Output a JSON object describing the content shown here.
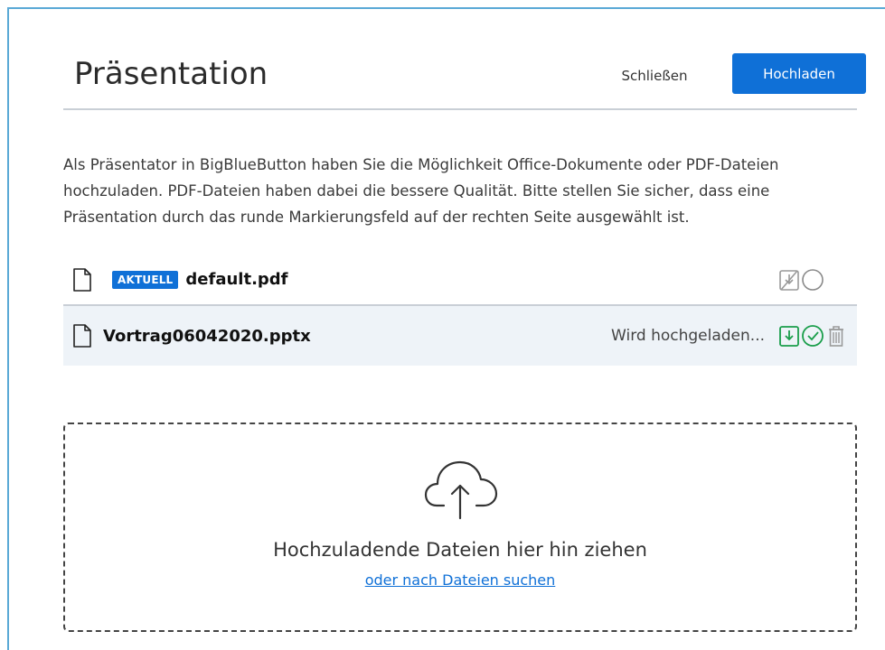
{
  "modal": {
    "title": "Präsentation",
    "close_label": "Schließen",
    "upload_label": "Hochladen",
    "description": "Als Präsentator in BigBlueButton haben Sie die Möglichkeit Office-Dokumente oder PDF-Dateien hochzuladen. PDF-Dateien haben dabei die bessere Qualität. Bitte stellen Sie sicher, dass eine Präsentation durch das runde Markierungsfeld auf der rechten Seite ausgewählt ist."
  },
  "files": [
    {
      "badge": "AKTUELL",
      "name": "default.pdf",
      "status": "",
      "icons": [
        "file-icon",
        "download-disabled-icon",
        "radio-unchecked-icon"
      ]
    },
    {
      "badge": "",
      "name": "Vortrag06042020.pptx",
      "status": "Wird hochgeladen...",
      "icons": [
        "file-icon",
        "download-enabled-icon",
        "radio-checked-icon",
        "trash-icon"
      ]
    }
  ],
  "dropzone": {
    "text": "Hochzuladende Dateien hier hin ziehen",
    "browse_link": "oder nach Dateien suchen",
    "icon": "cloud-upload-icon"
  },
  "colors": {
    "primary": "#0f70d7",
    "success": "#1a9e4b",
    "border": "#c9cfd6",
    "row_highlight": "#eef3f8"
  }
}
